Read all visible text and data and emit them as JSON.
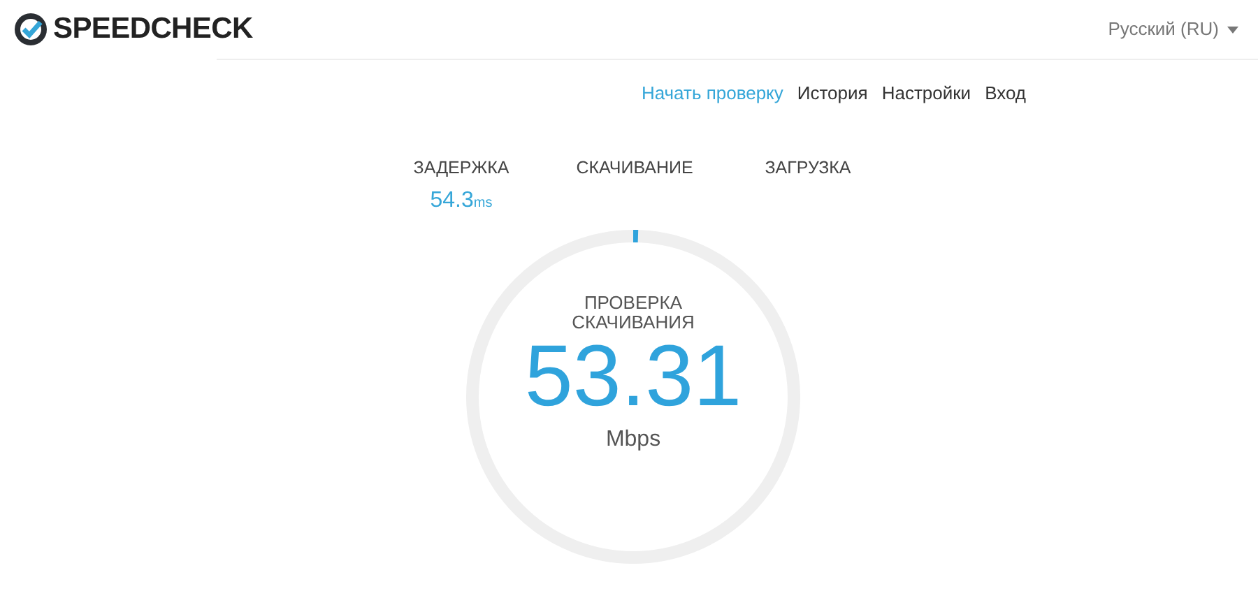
{
  "header": {
    "logo": "SPEEDCHECK",
    "language": "Русский (RU)"
  },
  "nav": [
    {
      "label": "Начать проверку",
      "selected": true
    },
    {
      "label": "История",
      "selected": false
    },
    {
      "label": "Настройки",
      "selected": false
    },
    {
      "label": "Вход",
      "selected": false
    }
  ],
  "stats": [
    {
      "label": "ЗАДЕРЖКА",
      "value": "54.3",
      "unit": "ms"
    },
    {
      "label": "СКАЧИВАНИЕ"
    },
    {
      "label": "ЗАГРУЗКА"
    }
  ],
  "gauge": {
    "caption": "ПРОВЕРКА СКАЧИВАНИЯ",
    "value": "53.31",
    "unit": "Mbps"
  }
}
